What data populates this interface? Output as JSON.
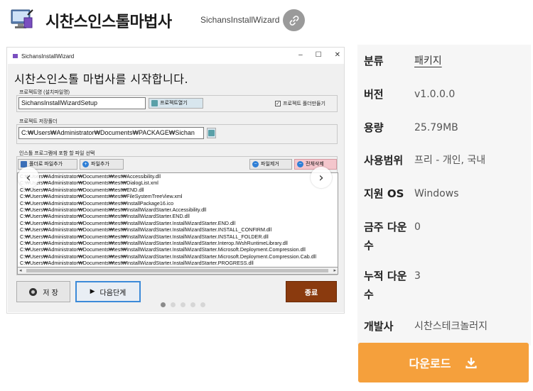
{
  "header": {
    "title": "시찬스인스톨마법사",
    "subtitle": "SichansInstallWizard"
  },
  "screenshot": {
    "window_title": "SichansInstallWizard",
    "window_controls": [
      "–",
      "☐",
      "✕"
    ],
    "heading": "시찬스인스톨 마법사를 시작합니다.",
    "project_name_label": "프로젝트명 (설치파일명)",
    "project_name_value": "SichansInstallWizardSetup",
    "open_project_button": "프로젝트열기",
    "make_folder_checkbox": "프로젝트 폴더만들기",
    "save_folder_label": "프로젝트 저장폴더",
    "save_folder_value": "C:₩Users₩Administrator₩Documents₩PACKAGE₩Sichan",
    "files_group_label": "인스톨 프로그램에 포함 할 파일 선택",
    "add_folder_button": "폴더로 파일추가",
    "add_file_button": "파일추가",
    "remove_file_button": "파일제거",
    "remove_all_button": "전체삭제",
    "files": [
      "C:₩Users₩Administrator₩Documents₩test₩Accessibility.dll",
      "C:₩Users₩Administrator₩Documents₩test₩DialogList.xml",
      "C:₩Users₩Administrator₩Documents₩test₩END.dll",
      "C:₩Users₩Administrator₩Documents₩test₩FileSystemTreeView.xml",
      "C:₩Users₩Administrator₩Documents₩test₩InstallPackage16.ico",
      "C:₩Users₩Administrator₩Documents₩test₩InstallWizardStarter.Accessibility.dll",
      "C:₩Users₩Administrator₩Documents₩test₩InstallWizardStarter.END.dll",
      "C:₩Users₩Administrator₩Documents₩test₩InstallWizardStarter.InstallWizardStarter.END.dll",
      "C:₩Users₩Administrator₩Documents₩test₩InstallWizardStarter.InstallWizardStarter.INSTALL_CONFIRM.dll",
      "C:₩Users₩Administrator₩Documents₩test₩InstallWizardStarter.InstallWizardStarter.INSTALL_FOLDER.dll",
      "C:₩Users₩Administrator₩Documents₩test₩InstallWizardStarter.InstallWizardStarter.Interop.IWshRuntimeLibrary.dll",
      "C:₩Users₩Administrator₩Documents₩test₩InstallWizardStarter.InstallWizardStarter.Microsoft.Deployment.Compression.dll",
      "C:₩Users₩Administrator₩Documents₩test₩InstallWizardStarter.InstallWizardStarter.Microsoft.Deployment.Compression.Cab.dll",
      "C:₩Users₩Administrator₩Documents₩test₩InstallWizardStarter.InstallWizardStarter.PROGRESS.dll"
    ],
    "save_button": "저 장",
    "next_button": "다음단계",
    "exit_button": "종료",
    "slide_count": 5,
    "active_slide": 1
  },
  "info": {
    "rows": [
      {
        "label": "분류",
        "value": "패키지"
      },
      {
        "label": "버전",
        "value": "v1.0.0.0"
      },
      {
        "label": "용량",
        "value": "25.79MB"
      },
      {
        "label": "사용범위",
        "value": "프리 - 개인, 국내"
      },
      {
        "label": "지원 OS",
        "value": "Windows"
      },
      {
        "label": "금주 다운수",
        "value": "0"
      },
      {
        "label": "누적 다운수",
        "value": "3"
      },
      {
        "label": "개발사",
        "value": "시찬스테크놀러지"
      }
    ]
  },
  "download": {
    "label": "다운로드"
  },
  "colors": {
    "download": "#f5a03c",
    "share": "#9a9a9a",
    "info_bg": "#f6f6f6",
    "exit_button": "#8a3a0e"
  }
}
